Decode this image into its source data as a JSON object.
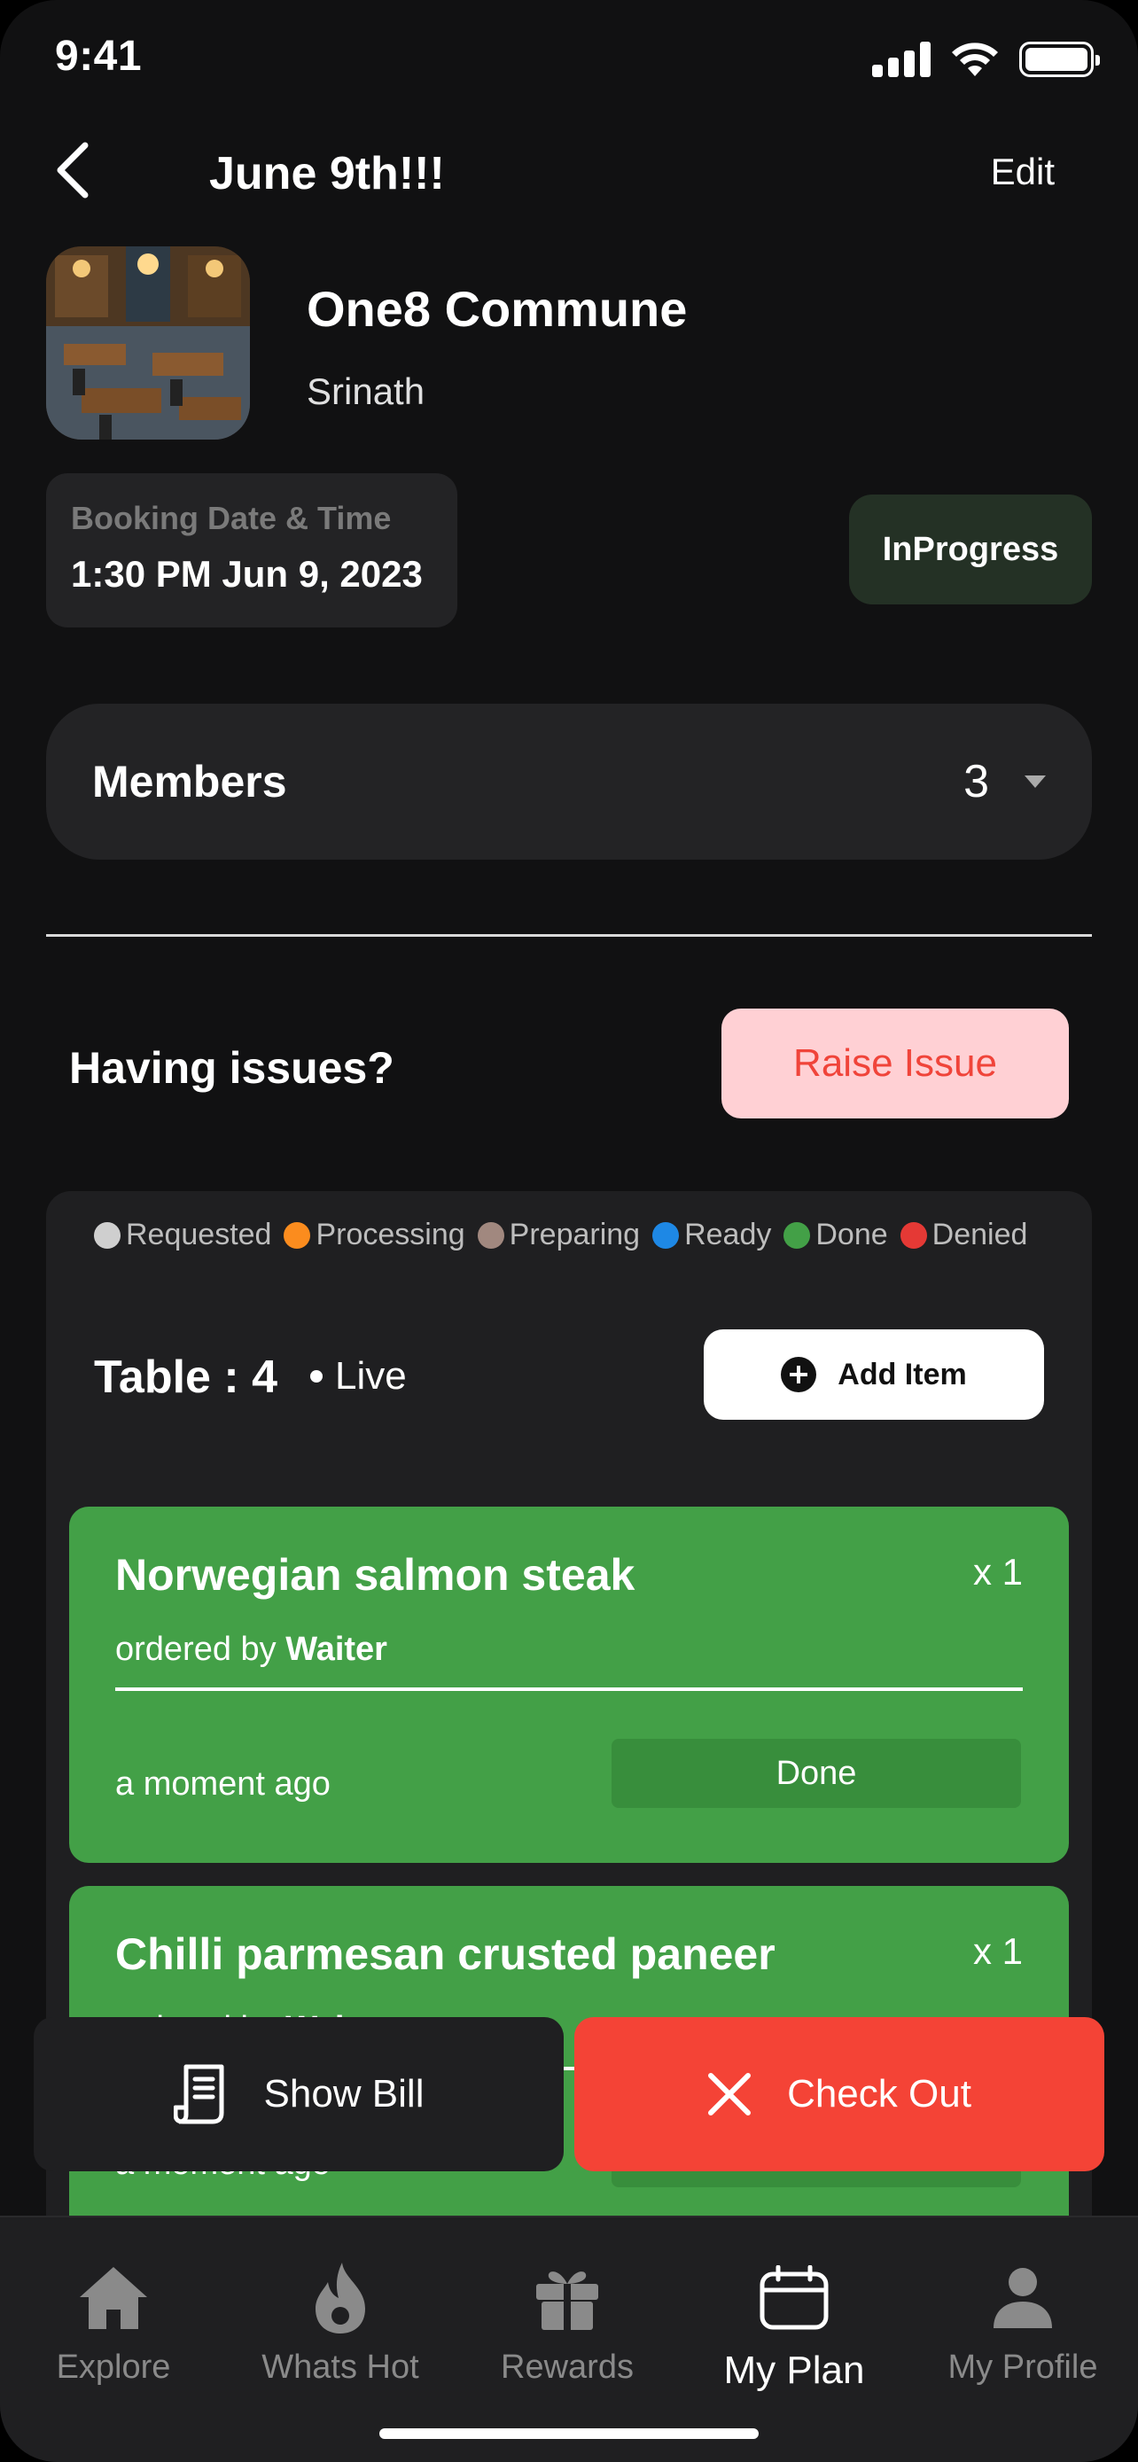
{
  "status_bar": {
    "time": "9:41"
  },
  "header": {
    "title": "June 9th!!!",
    "edit_label": "Edit"
  },
  "venue": {
    "name": "One8 Commune",
    "owner": "Srinath"
  },
  "booking": {
    "label": "Booking Date & Time",
    "value": "1:30 PM Jun 9, 2023",
    "status": "InProgress"
  },
  "members": {
    "label": "Members",
    "count": "3"
  },
  "issues": {
    "label": "Having issues?",
    "button": "Raise Issue"
  },
  "legend": [
    {
      "label": "Requested",
      "color": "#cfcfcf"
    },
    {
      "label": "Processing",
      "color": "#fb8c1e"
    },
    {
      "label": "Preparing",
      "color": "#a1887f"
    },
    {
      "label": "Ready",
      "color": "#1e88e5"
    },
    {
      "label": "Done",
      "color": "#43a047"
    },
    {
      "label": "Denied",
      "color": "#e53935"
    }
  ],
  "table": {
    "label": "Table : 4",
    "live": "Live",
    "add_item": "Add Item"
  },
  "orders": [
    {
      "name": "Norwegian salmon steak",
      "qty": "x 1",
      "ordered_by_prefix": "ordered by",
      "ordered_by": "Waiter",
      "time": "a moment ago",
      "status": "Done"
    },
    {
      "name": "Chilli parmesan crusted paneer",
      "qty": "x 1",
      "ordered_by_prefix": "ordered by",
      "ordered_by": "Waiter",
      "time": "a moment ago",
      "status": "Done"
    }
  ],
  "actions": {
    "show_bill": "Show Bill",
    "check_out": "Check Out"
  },
  "nav": {
    "items": [
      {
        "label": "Explore",
        "icon": "home-icon"
      },
      {
        "label": "Whats Hot",
        "icon": "flame-icon"
      },
      {
        "label": "Rewards",
        "icon": "gift-icon"
      },
      {
        "label": "My Plan",
        "icon": "calendar-icon",
        "active": true
      },
      {
        "label": "My Profile",
        "icon": "person-icon"
      }
    ]
  },
  "colors": {
    "accent_green": "#43a047",
    "checkout_red": "#f44336",
    "raise_issue_bg": "#ffd0d4"
  }
}
